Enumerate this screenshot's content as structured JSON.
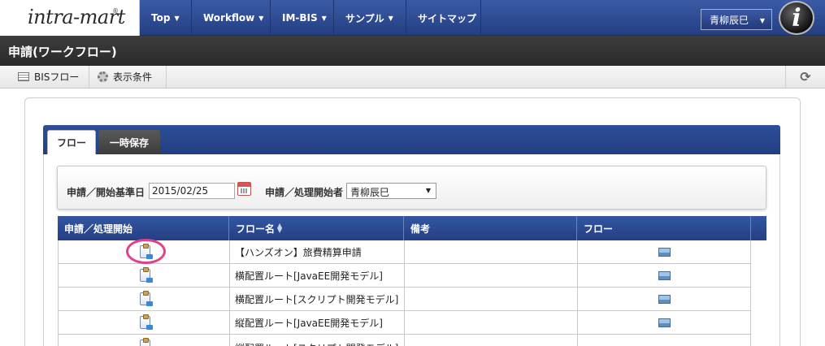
{
  "logo": {
    "text": "intra-mart",
    "reg": "®"
  },
  "nav": {
    "items": [
      {
        "label": "Top",
        "has_caret": true
      },
      {
        "label": "Workflow",
        "has_caret": true
      },
      {
        "label": "IM-BIS",
        "has_caret": true
      },
      {
        "label": "サンプル",
        "has_caret": true
      },
      {
        "label": "サイトマップ",
        "has_caret": false
      }
    ],
    "user_name": "青柳辰巳",
    "avatar_letter": "i"
  },
  "title": "申請(ワークフロー)",
  "toolbar": {
    "bis_flow_label": "BISフロー",
    "display_conditions_label": "表示条件",
    "refresh_icon": "⟳"
  },
  "tabs": [
    {
      "label": "フロー",
      "active": true
    },
    {
      "label": "一時保存",
      "active": false
    }
  ],
  "search": {
    "base_date_label": "申請／開始基準日",
    "base_date_value": "2015/02/25",
    "applicant_label": "申請／処理開始者",
    "applicant_value": "青柳辰巳"
  },
  "table": {
    "headers": [
      "申請／処理開始",
      "フロー名",
      "備考",
      "フロー"
    ],
    "rows": [
      {
        "flow_name": "【ハンズオン】旅費精算申請",
        "note": ""
      },
      {
        "flow_name": "横配置ルート[JavaEE開発モデル]",
        "note": ""
      },
      {
        "flow_name": "横配置ルート[スクリプト開発モデル]",
        "note": ""
      },
      {
        "flow_name": "縦配置ルート[JavaEE開発モデル]",
        "note": ""
      },
      {
        "flow_name": "縦配置ルート[スクリプト開発モデル]",
        "note": ""
      }
    ]
  },
  "colors": {
    "nav_blue": "#2d4a8f",
    "title_dark": "#333333",
    "highlight_pink": "#e2418a"
  }
}
